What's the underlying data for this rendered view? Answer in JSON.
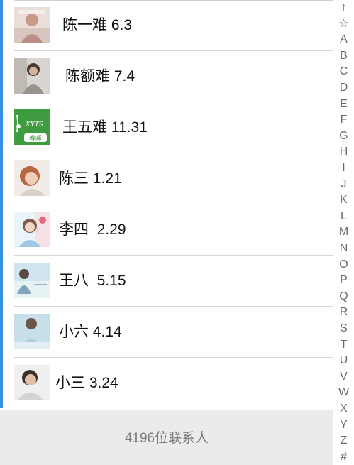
{
  "contacts": [
    {
      "name": "陈一难 6.3",
      "avatar": "avatar-photo-icon"
    },
    {
      "name": "陈额难 7.4",
      "avatar": "avatar-photo-icon"
    },
    {
      "name": "王五难 11.31",
      "avatar": "green-logo-avatar-icon"
    },
    {
      "name": "陈三 1.21",
      "avatar": "avatar-photo-icon"
    },
    {
      "name": "李四  2.29",
      "avatar": "avatar-photo-icon"
    },
    {
      "name": "王八  5.15",
      "avatar": "avatar-photo-icon"
    },
    {
      "name": "小六 4.14",
      "avatar": "avatar-photo-icon"
    },
    {
      "name": "小三 3.24",
      "avatar": "avatar-photo-icon"
    }
  ],
  "green_avatar_text": {
    "line1": "XYTS",
    "line2": "春晖"
  },
  "footer": {
    "count_label": "4196位联系人"
  },
  "index_bar": {
    "items": [
      "↑",
      "☆",
      "A",
      "B",
      "C",
      "D",
      "E",
      "F",
      "G",
      "H",
      "I",
      "J",
      "K",
      "L",
      "M",
      "N",
      "O",
      "P",
      "Q",
      "R",
      "S",
      "T",
      "U",
      "V",
      "W",
      "X",
      "Y",
      "Z",
      "#"
    ]
  },
  "colors": {
    "accent": "#3a8fe0",
    "separator": "#d6d6d6",
    "footer_bg": "#ebebeb",
    "footer_text": "#7a7a7a",
    "index_text": "#6b6b6b",
    "green_avatar": "#3f9b3f"
  }
}
